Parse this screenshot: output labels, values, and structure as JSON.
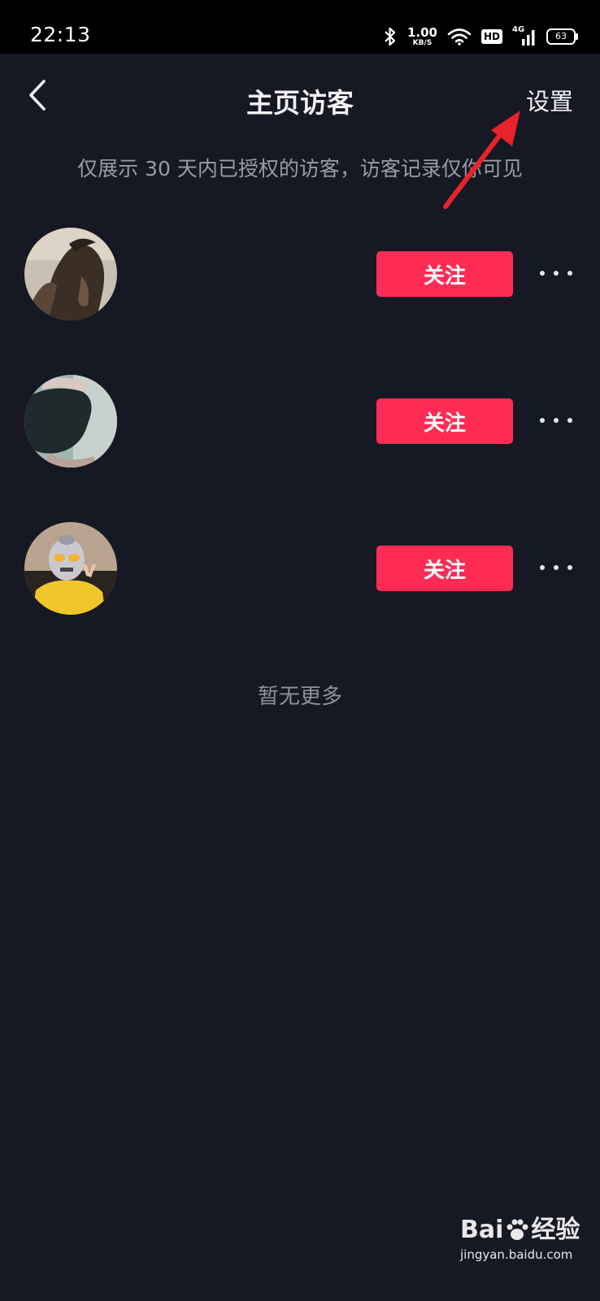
{
  "status_bar": {
    "time": "22:13",
    "net_speed_value": "1.00",
    "net_speed_unit": "KB/S",
    "hd_label": "HD",
    "network_type": "4G",
    "battery_level": "63",
    "icons": [
      "bluetooth-icon",
      "wifi-icon",
      "hd-icon",
      "signal-icon",
      "battery-icon"
    ]
  },
  "header": {
    "title": "主页访客",
    "settings_label": "设置"
  },
  "notice": "仅展示 30 天内已授权的访客，访客记录仅你可见",
  "visitors": [
    {
      "follow_label": "关注"
    },
    {
      "follow_label": "关注"
    },
    {
      "follow_label": "关注"
    }
  ],
  "end_text": "暂无更多",
  "watermark": {
    "brand_left": "Bai",
    "brand_right": "经验",
    "url": "jingyan.baidu.com"
  },
  "colors": {
    "background": "#161823",
    "accent": "#fe2c55",
    "annotation": "#e8232b"
  }
}
